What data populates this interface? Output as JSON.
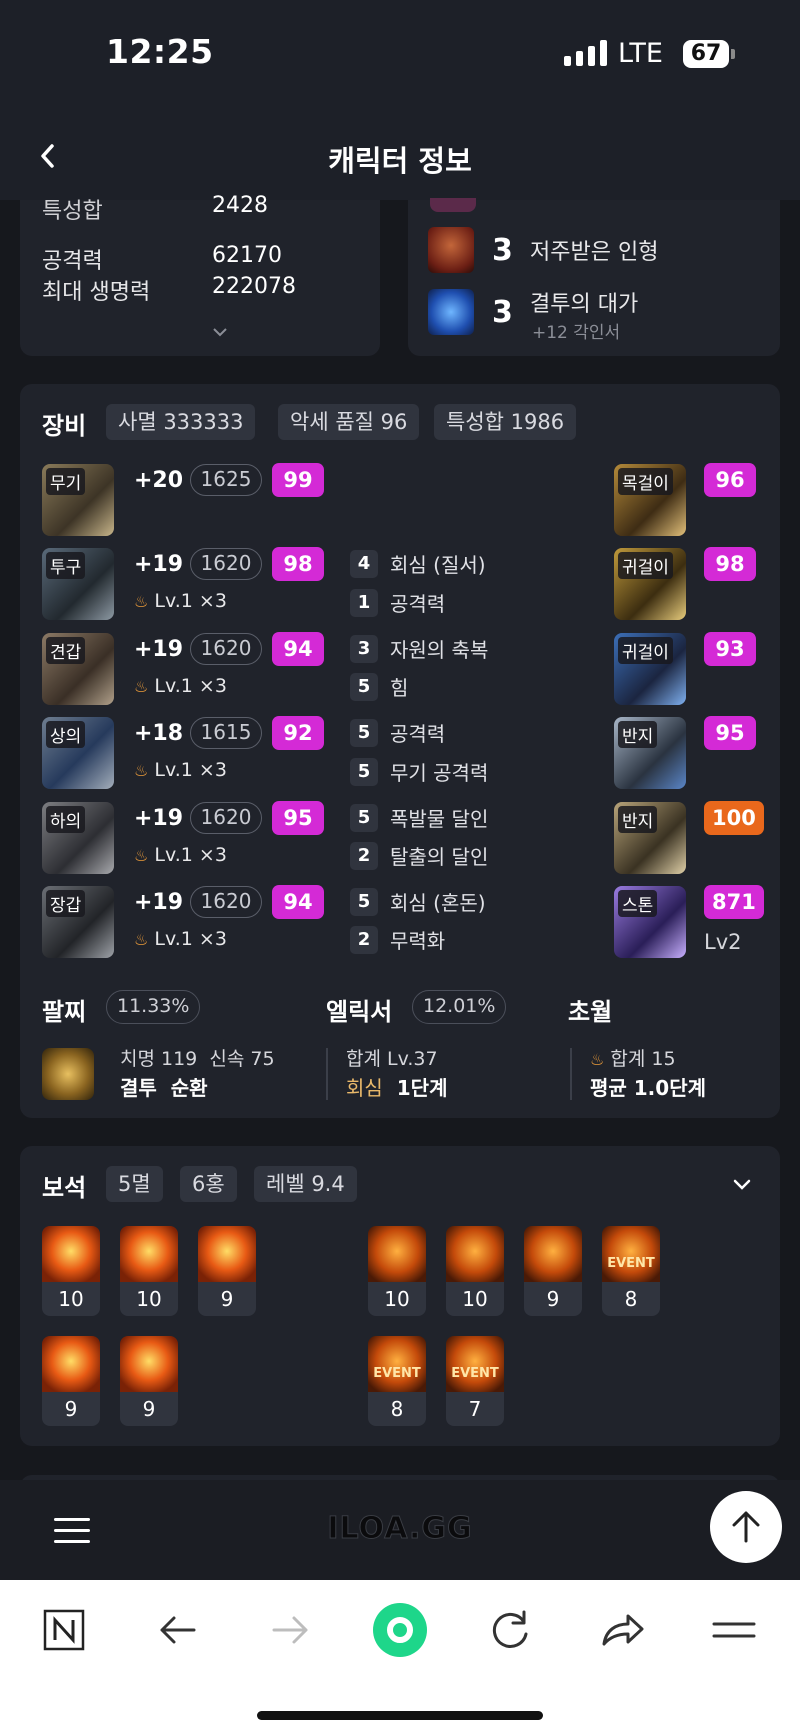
{
  "status": {
    "time": "12:25",
    "network": "LTE",
    "battery": "67"
  },
  "header": {
    "title": "캐릭터 정보"
  },
  "stats": {
    "partial_label": "특성합",
    "partial_value": "2428",
    "attack_label": "공격력",
    "attack_value": "62170",
    "hp_label": "최대 생명력",
    "hp_value": "222078"
  },
  "engravings": [
    {
      "count": "3",
      "name": "저주받은 인형",
      "sub": ""
    },
    {
      "count": "3",
      "name": "결투의 대가",
      "sub": "+12 각인서"
    }
  ],
  "equipment": {
    "title": "장비",
    "chips": [
      "사멸 333333",
      "악세 품질 96",
      "특성합 1986"
    ],
    "left": [
      {
        "label": "무기",
        "plus": "+20",
        "ilvl": "1625",
        "quality": "99",
        "level": ""
      },
      {
        "label": "투구",
        "plus": "+19",
        "ilvl": "1620",
        "quality": "98",
        "level": "Lv.1 ×3"
      },
      {
        "label": "견갑",
        "plus": "+19",
        "ilvl": "1620",
        "quality": "94",
        "level": "Lv.1 ×3"
      },
      {
        "label": "상의",
        "plus": "+18",
        "ilvl": "1615",
        "quality": "92",
        "level": "Lv.1 ×3"
      },
      {
        "label": "하의",
        "plus": "+19",
        "ilvl": "1620",
        "quality": "95",
        "level": "Lv.1 ×3"
      },
      {
        "label": "장갑",
        "plus": "+19",
        "ilvl": "1620",
        "quality": "94",
        "level": "Lv.1 ×3"
      }
    ],
    "effects": [
      {
        "n": "4",
        "name": "회심 (질서)"
      },
      {
        "n": "1",
        "name": "공격력"
      },
      {
        "n": "3",
        "name": "자원의 축복"
      },
      {
        "n": "5",
        "name": "힘"
      },
      {
        "n": "5",
        "name": "공격력"
      },
      {
        "n": "5",
        "name": "무기 공격력"
      },
      {
        "n": "5",
        "name": "폭발물 달인"
      },
      {
        "n": "2",
        "name": "탈출의 달인"
      },
      {
        "n": "5",
        "name": "회심 (혼돈)"
      },
      {
        "n": "2",
        "name": "무력화"
      }
    ],
    "right": [
      {
        "label": "목걸이",
        "value": "96"
      },
      {
        "label": "귀걸이",
        "value": "98"
      },
      {
        "label": "귀걸이",
        "value": "93"
      },
      {
        "label": "반지",
        "value": "95"
      },
      {
        "label": "반지",
        "value": "100"
      },
      {
        "label": "스톤",
        "value": "871",
        "extra": "Lv2"
      }
    ],
    "bracelet": {
      "title": "팔찌",
      "pct": "11.33%",
      "line1a": "치명 119",
      "line1b": "신속 75",
      "line2a": "결투",
      "line2b": "순환"
    },
    "elixir": {
      "title": "엘릭서",
      "pct": "12.01%",
      "line1": "합계 Lv.37",
      "line2a": "회심",
      "line2b": "1단계"
    },
    "transcend": {
      "title": "초월",
      "line1": "합계 15",
      "line2": "평균 1.0단계"
    }
  },
  "gems": {
    "title": "보석",
    "chips": [
      "5멸",
      "6홍",
      "레벨 9.4"
    ],
    "damage_row1": [
      "10",
      "10",
      "9"
    ],
    "damage_row2": [
      "9",
      "9"
    ],
    "cooldown_row1": [
      "10",
      "10",
      "9",
      "8"
    ],
    "cooldown_row2": [
      "8",
      "7"
    ],
    "event_label": "EVENT"
  },
  "site": {
    "logo": "ILOA.GG"
  },
  "colors": {
    "quality_pink": "#d42ad6",
    "quality_orange": "#e9681c",
    "card": "#20232b",
    "bg": "#16181d"
  }
}
